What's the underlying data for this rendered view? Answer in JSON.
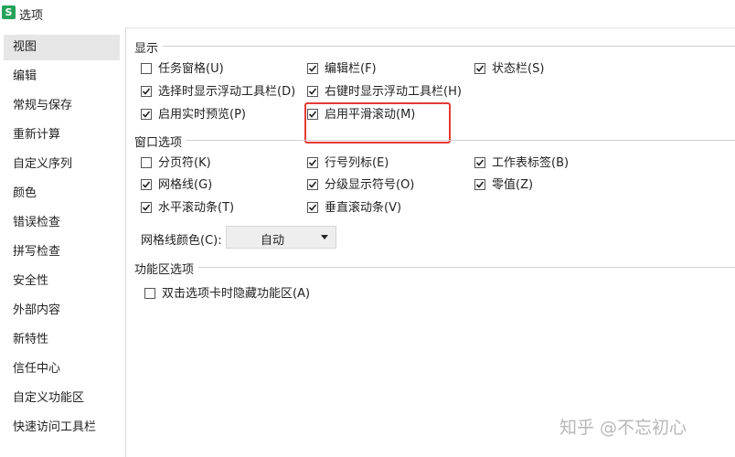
{
  "window": {
    "title": "选项",
    "app_icon_letter": "S"
  },
  "sidebar": {
    "items": [
      {
        "label": "视图",
        "active": true
      },
      {
        "label": "编辑"
      },
      {
        "label": "常规与保存"
      },
      {
        "label": "重新计算"
      },
      {
        "label": "自定义序列"
      },
      {
        "label": "颜色"
      },
      {
        "label": "错误检查"
      },
      {
        "label": "拼写检查"
      },
      {
        "label": "安全性"
      },
      {
        "label": "外部内容"
      },
      {
        "label": "新特性"
      },
      {
        "label": "信任中心"
      },
      {
        "label": "自定义功能区"
      },
      {
        "label": "快速访问工具栏"
      }
    ]
  },
  "display": {
    "title": "显示",
    "options": [
      {
        "label": "任务窗格(U)",
        "checked": false
      },
      {
        "label": "编辑栏(F)",
        "checked": true
      },
      {
        "label": "状态栏(S)",
        "checked": true
      },
      {
        "label": "选择时显示浮动工具栏(D)",
        "checked": true
      },
      {
        "label": "右键时显示浮动工具栏(H)",
        "checked": true
      },
      {
        "label": "启用实时预览(P)",
        "checked": true
      },
      {
        "label": "启用平滑滚动(M)",
        "checked": true
      }
    ]
  },
  "window_options": {
    "title": "窗口选项",
    "options": [
      {
        "label": "分页符(K)",
        "checked": false
      },
      {
        "label": "行号列标(E)",
        "checked": true
      },
      {
        "label": "工作表标签(B)",
        "checked": true
      },
      {
        "label": "网格线(G)",
        "checked": true
      },
      {
        "label": "分级显示符号(O)",
        "checked": true
      },
      {
        "label": "零值(Z)",
        "checked": true
      },
      {
        "label": "水平滚动条(T)",
        "checked": true
      },
      {
        "label": "垂直滚动条(V)",
        "checked": true
      }
    ],
    "gridline_color": {
      "label": "网格线颜色(C):",
      "value": "自动"
    }
  },
  "ribbon": {
    "title": "功能区选项",
    "options": [
      {
        "label": "双击选项卡时隐藏功能区(A)",
        "checked": false
      }
    ]
  },
  "watermark": "知乎 @不忘初心",
  "colors": {
    "highlight": "#e53935",
    "active_item_bg": "#e6e6e6"
  }
}
